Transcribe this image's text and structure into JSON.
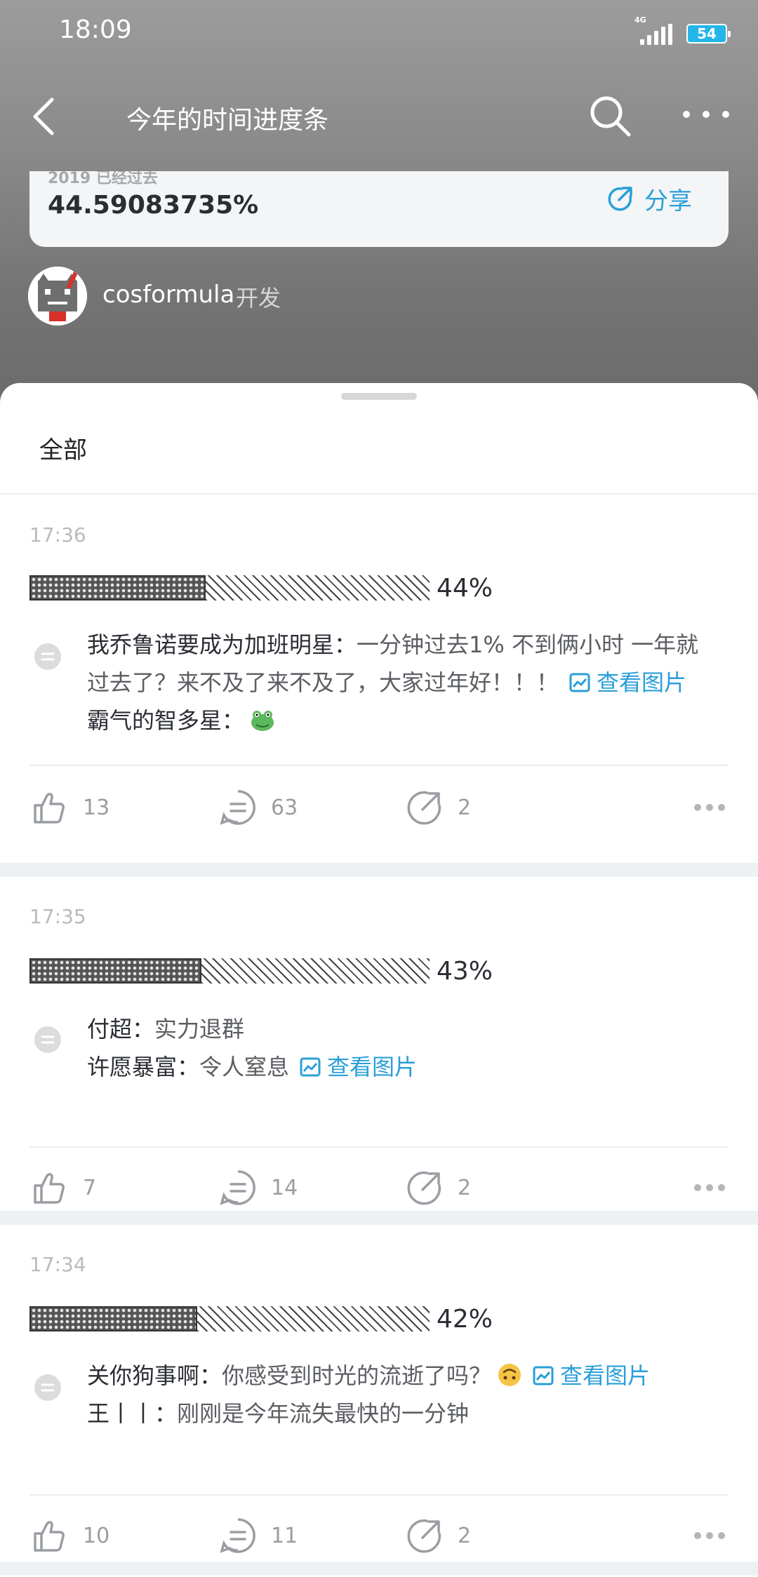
{
  "status": {
    "time": "18:09",
    "network": "4G",
    "battery": "54"
  },
  "nav": {
    "title": "今年的时间进度条"
  },
  "card": {
    "subtitle": "2019 已经过去",
    "value": "44.59083735%",
    "share_label": "分享"
  },
  "author": {
    "name": "cosformula",
    "role": "开发"
  },
  "tabs": {
    "all": "全部"
  },
  "colors": {
    "accent": "#2a9fd8",
    "battery": "#24b6e8"
  },
  "posts": [
    {
      "time": "17:36",
      "percent": "44%",
      "progress": 0.44,
      "comments": [
        {
          "user": "我乔鲁诺要成为加班明星：",
          "text": "一分钟过去1% 不到俩小时 一年就过去了？来不及了来不及了，大家过年好！！！",
          "image_link": "查看图片"
        },
        {
          "user": "霸气的智多星：",
          "text": "",
          "emoji": "frog-emoji"
        }
      ],
      "likes": "13",
      "replies": "63",
      "shares": "2"
    },
    {
      "time": "17:35",
      "percent": "43%",
      "progress": 0.43,
      "comments": [
        {
          "user": "付超：",
          "text": "实力退群"
        },
        {
          "user": "许愿暴富：",
          "text": "令人窒息",
          "image_link": "查看图片"
        }
      ],
      "likes": "7",
      "replies": "14",
      "shares": "2"
    },
    {
      "time": "17:34",
      "percent": "42%",
      "progress": 0.42,
      "comments": [
        {
          "user": "关你狗事啊：",
          "text": "你感受到时光的流逝了吗？",
          "emoji": "upside-down-face-emoji",
          "image_link": "查看图片"
        },
        {
          "user": "王丨丨：",
          "text": "刚刚是今年流失最快的一分钟"
        }
      ],
      "likes": "10",
      "replies": "11",
      "shares": "2"
    }
  ]
}
